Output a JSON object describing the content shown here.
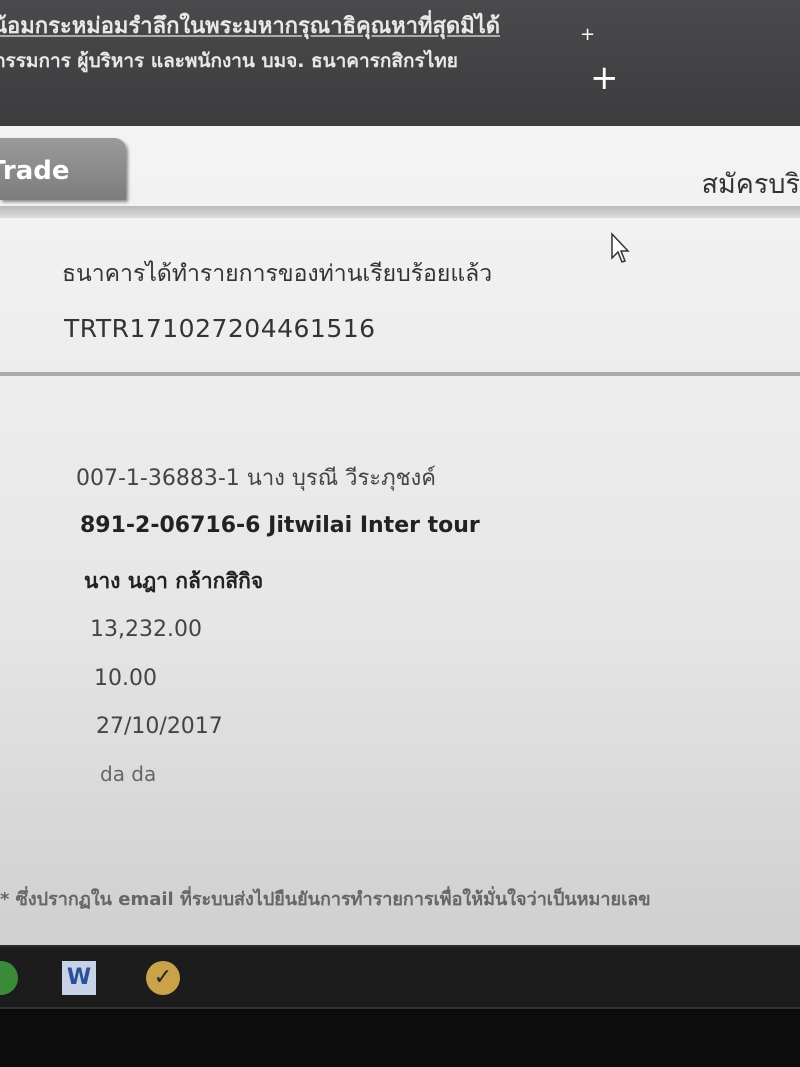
{
  "banner": {
    "line1": "น้อมกระหม่อมรำลึกในพระมหากรุณาธิคุณหาที่สุดมิได้",
    "line2": "กรรมการ ผู้บริหาร และพนักงาน บมจ. ธนาคารกสิกรไทย"
  },
  "nav": {
    "tab_label": "Trade",
    "register_label": "สมัครบริ"
  },
  "result": {
    "message": "ธนาคารได้ทำรายการของท่านเรียบร้อยแล้ว",
    "reference": "TRTR171027204461516"
  },
  "details": {
    "from_account": "007-1-36883-1 นาง บุรณี วีระภุชงค์",
    "to_account": "891-2-06716-6 Jitwilai Inter tour",
    "recipient_name": "นาง นฎา กล้ากสิกิจ",
    "amount": "13,232.00",
    "fee": "10.00",
    "date": "27/10/2017",
    "note": "da da"
  },
  "footer": {
    "text": "* ซึ่งปรากฏใน email ที่ระบบส่งไปยืนยันการทำรายการเพื่อให้มั่นใจว่าเป็นหมายเลข"
  },
  "taskbar": {
    "icons": [
      "app-green-icon",
      "word-icon",
      "checkmark-app-icon"
    ]
  }
}
